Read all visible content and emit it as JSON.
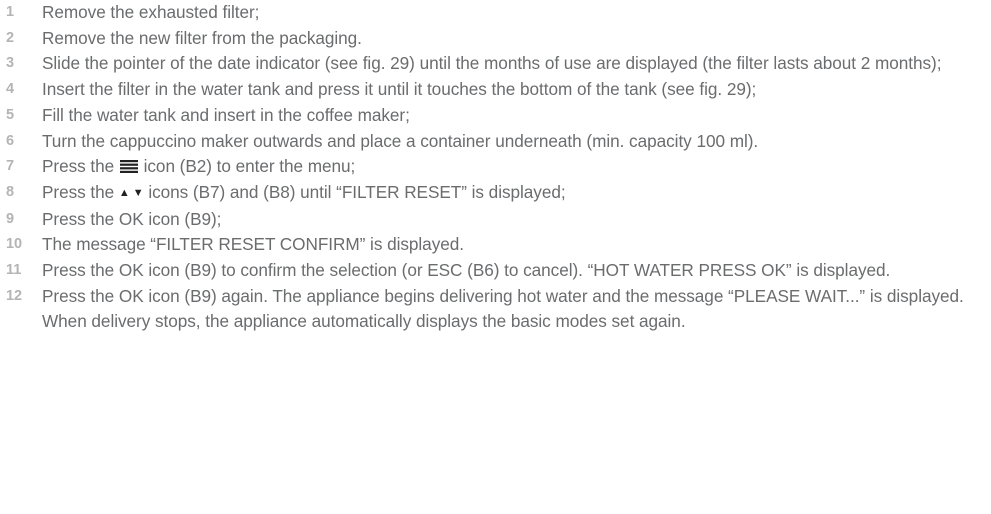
{
  "steps": [
    {
      "num": "1",
      "text": "Remove the exhausted filter;"
    },
    {
      "num": "2",
      "text": "Remove the new filter from the packaging."
    },
    {
      "num": "3",
      "text": "Slide the pointer of the date indicator (see fig. 29) until the months of use are displayed (the filter lasts about 2 months);"
    },
    {
      "num": "4",
      "text": "Insert the filter in the water tank and press it until it touches the bottom of the tank (see fig. 29);"
    },
    {
      "num": "5",
      "text": "Fill the water tank and insert in the coffee maker;"
    },
    {
      "num": "6",
      "text": "Turn the cappuccino maker outwards and place a container underneath (min. capacity 100 ml)."
    },
    {
      "num": "7",
      "pre": "Press the",
      "post": "icon (B2) to enter the menu;",
      "icon": "menu-icon"
    },
    {
      "num": "8",
      "pre": "Press the",
      "arrows": "▲ ▼",
      "post": "icons (B7) and (B8) until “FILTER RESET” is displayed;"
    },
    {
      "num": "9",
      "text": "Press the OK icon (B9);"
    },
    {
      "num": "10",
      "text": "The message “FILTER RESET CONFIRM” is displayed."
    },
    {
      "num": "11",
      "text": "Press the OK icon (B9) to confirm the selection (or ESC (B6) to cancel). “HOT WATER PRESS OK” is displayed."
    },
    {
      "num": "12",
      "text": "Press the OK icon (B9) again. The appliance begins delivering hot water and the message “PLEASE WAIT...” is displayed. When delivery stops, the appliance automatically displays the basic modes set again."
    }
  ],
  "colors": {
    "text": "#6b6c6e",
    "number": "#b3b4b6",
    "icon": "#222222"
  }
}
